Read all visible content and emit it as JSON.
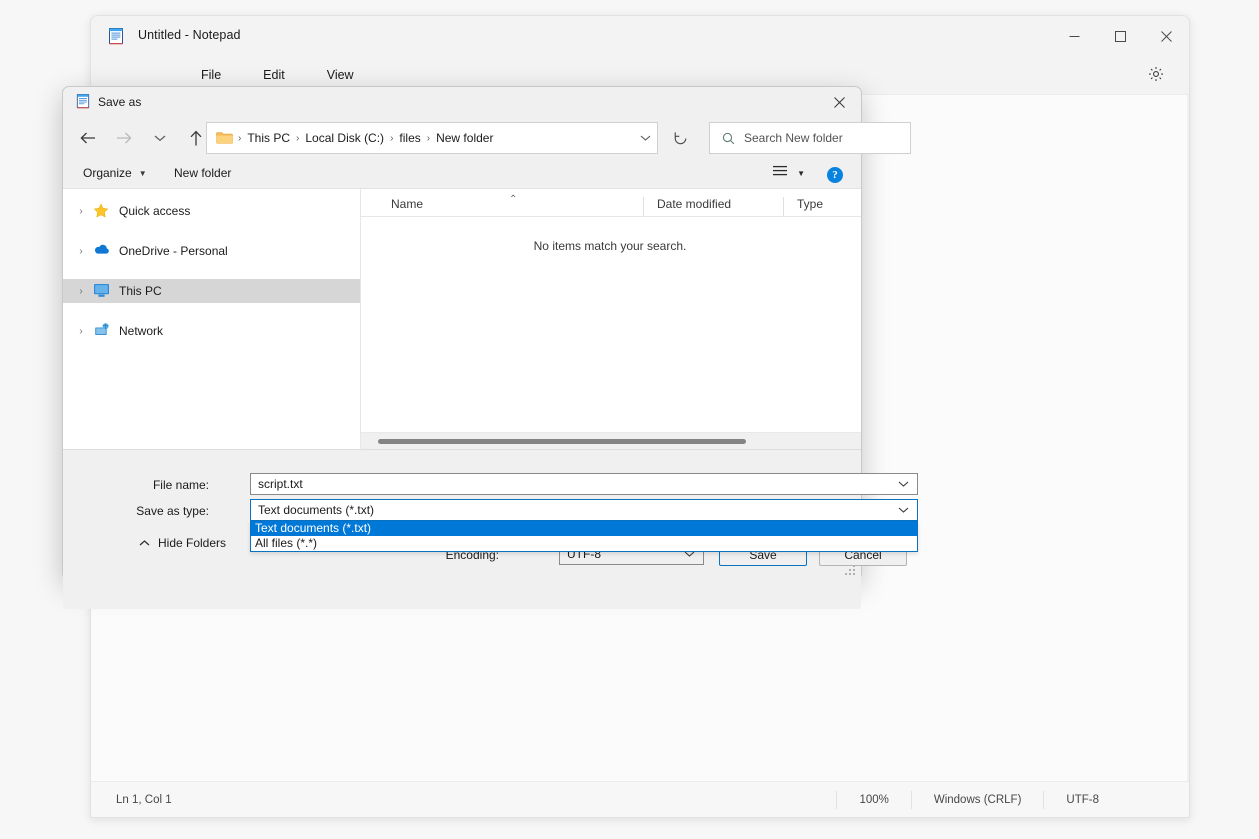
{
  "notepad": {
    "icon": "notepad-icon",
    "title": "Untitled - Notepad",
    "menus": [
      {
        "label": "File"
      },
      {
        "label": "Edit"
      },
      {
        "label": "View"
      }
    ],
    "window_controls": {
      "minimize": "minimize-icon",
      "maximize": "maximize-icon",
      "close": "close-icon"
    },
    "settings_icon": "gear-icon",
    "statusbar": {
      "cursor": "Ln 1, Col 1",
      "zoom": "100%",
      "line_endings": "Windows (CRLF)",
      "encoding": "UTF-8"
    }
  },
  "dialog": {
    "icon": "notepad-icon",
    "title": "Save as",
    "close_label": "close-icon",
    "nav": {
      "back": "back-arrow-icon",
      "forward": "forward-arrow-icon",
      "recent": "recent-locations-icon",
      "up": "up-arrow-icon",
      "refresh": "refresh-icon"
    },
    "breadcrumb": {
      "folder_icon": "folder-icon",
      "segments": [
        "This PC",
        "Local Disk (C:)",
        "files",
        "New folder"
      ],
      "separator": "›",
      "chevron": "chevron-down-icon"
    },
    "search": {
      "icon": "search-icon",
      "placeholder": "Search New folder",
      "value": ""
    },
    "toolbar": {
      "organize": "Organize",
      "new_folder": "New folder",
      "view_icon": "view-list-icon",
      "view_caret": "chevron-down-icon",
      "help_icon": "help-icon",
      "help_label": "?"
    },
    "tree": {
      "items": [
        {
          "label": "Quick access",
          "icon": "star-icon",
          "selected": false
        },
        {
          "label": "OneDrive - Personal",
          "icon": "cloud-icon",
          "selected": false
        },
        {
          "label": "This PC",
          "icon": "this-pc-icon",
          "selected": true
        },
        {
          "label": "Network",
          "icon": "network-icon",
          "selected": false
        }
      ],
      "expand_chevron": "›"
    },
    "file_list": {
      "columns": [
        "Name",
        "Date modified",
        "Type"
      ],
      "sort_indicator": "⌃",
      "rows": [],
      "empty_message": "No items match your search."
    },
    "form": {
      "filename_label": "File name:",
      "filename_value": "script.txt",
      "savetype_label": "Save as type:",
      "savetype_value": "Text documents (*.txt)",
      "savetype_options": [
        {
          "label": "Text documents (*.txt)",
          "selected": true
        },
        {
          "label": "All files  (*.*)",
          "selected": false
        }
      ],
      "encoding_label": "Encoding:",
      "encoding_value": "UTF-8",
      "save_button": "Save",
      "cancel_button": "Cancel",
      "hide_folders": "Hide Folders",
      "hide_folders_chevron": "chevron-up-icon"
    },
    "colors": {
      "highlight": "#0078d7",
      "focus_border": "#0a72c0",
      "accent_help": "#0a82e0",
      "selected_row": "#d6d6d6"
    }
  }
}
